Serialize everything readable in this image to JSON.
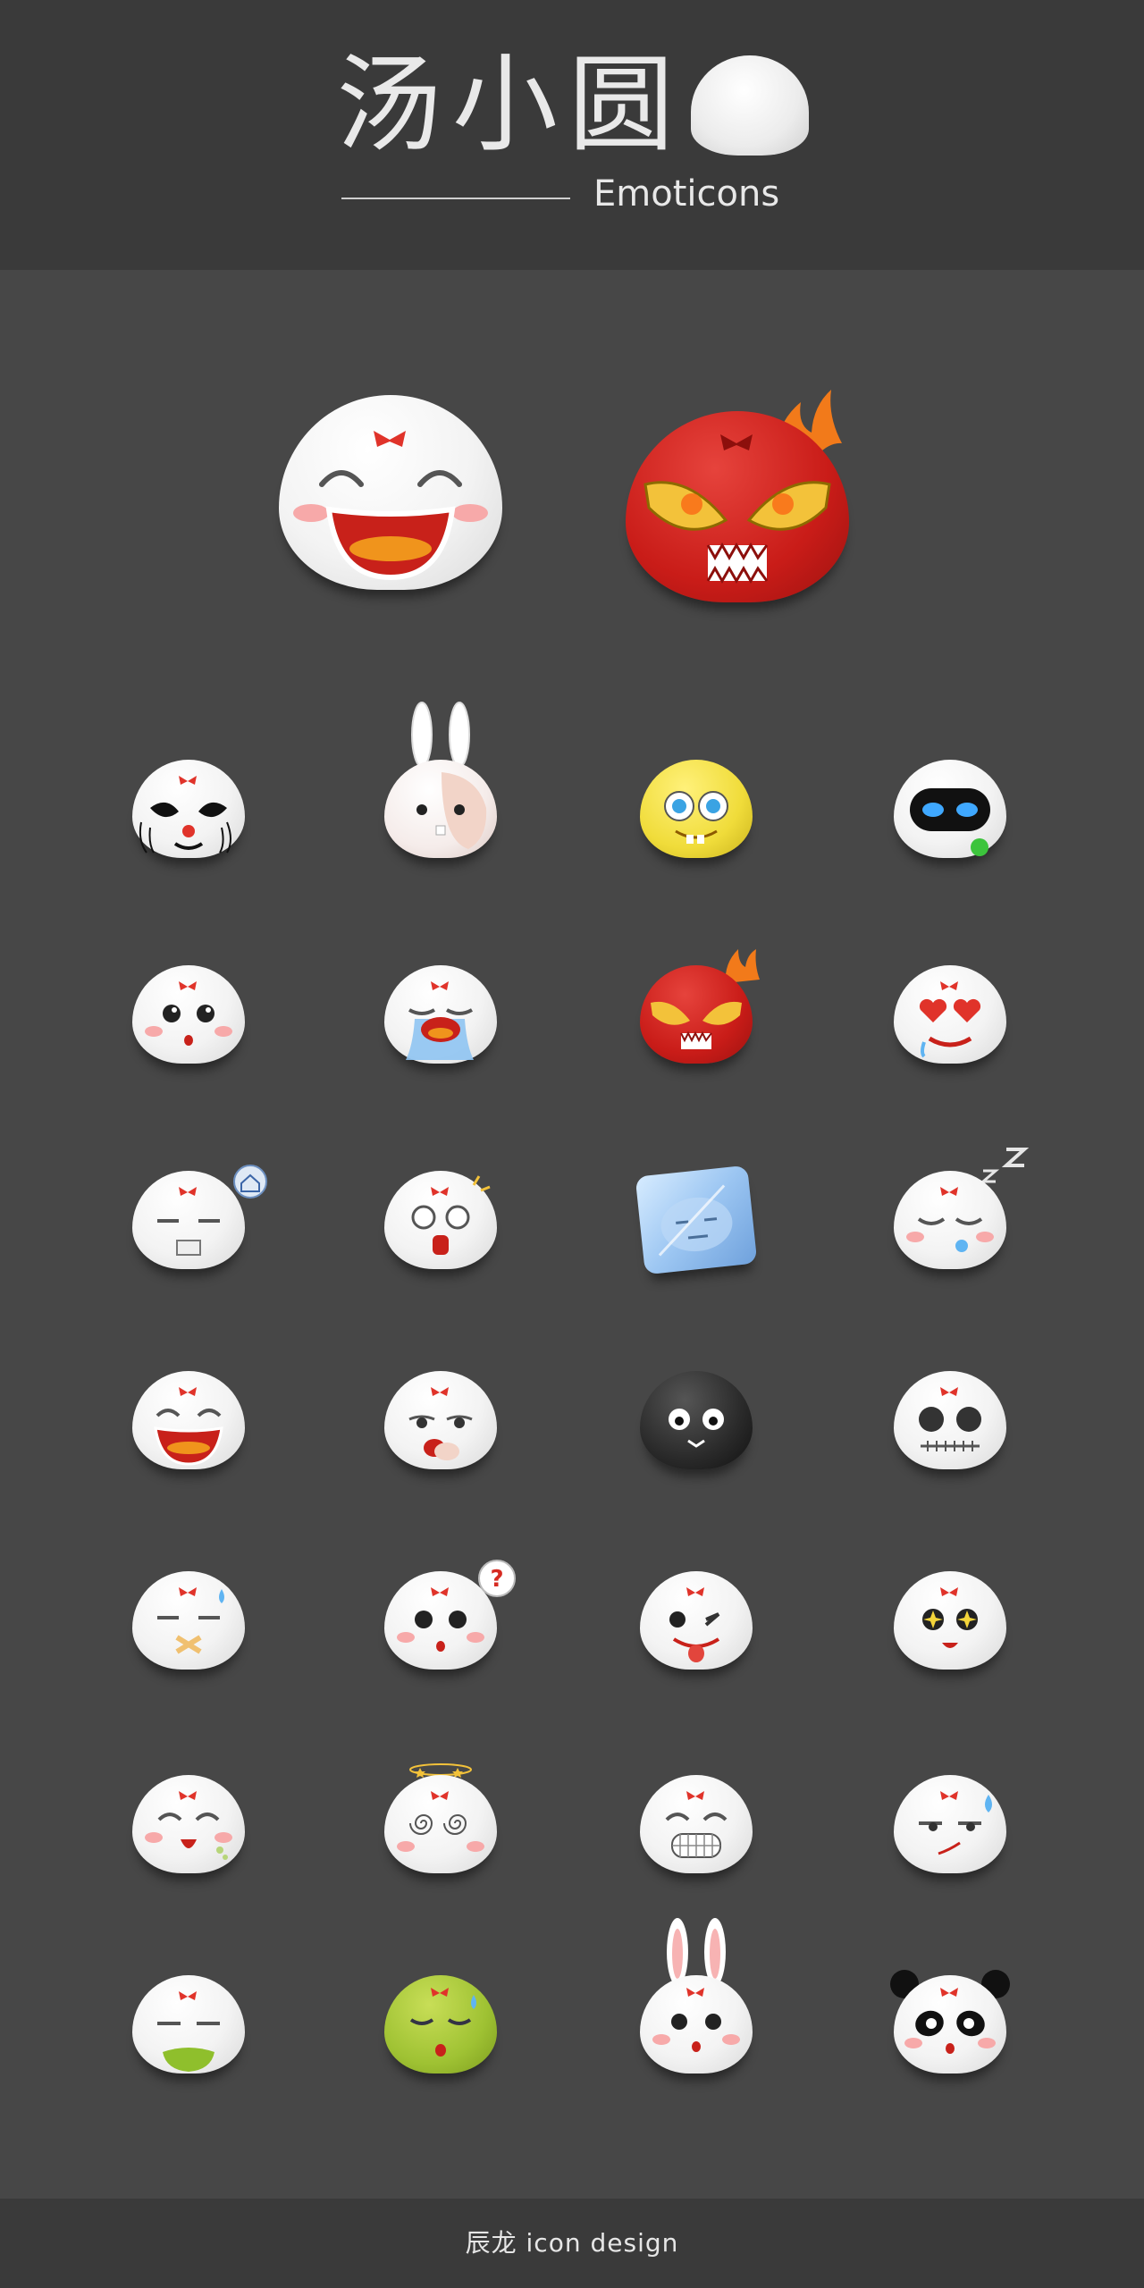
{
  "header": {
    "title": "汤小圆",
    "subtitle": "Emoticons"
  },
  "footer": {
    "credit": "辰龙 icon design"
  },
  "emoticons": [
    {
      "name": "laughing",
      "style": "white"
    },
    {
      "name": "furious",
      "style": "red"
    },
    {
      "name": "clown",
      "style": "white"
    },
    {
      "name": "bunny-patched",
      "style": "white"
    },
    {
      "name": "sponge",
      "style": "yellow"
    },
    {
      "name": "robot",
      "style": "white"
    },
    {
      "name": "surprised",
      "style": "white"
    },
    {
      "name": "crying",
      "style": "white"
    },
    {
      "name": "angry-fire",
      "style": "red"
    },
    {
      "name": "love-eyes",
      "style": "white"
    },
    {
      "name": "homesick",
      "style": "white"
    },
    {
      "name": "shocked",
      "style": "white"
    },
    {
      "name": "frozen",
      "style": "ice"
    },
    {
      "name": "sleeping",
      "style": "white"
    },
    {
      "name": "big-laugh",
      "style": "white"
    },
    {
      "name": "yawning",
      "style": "white"
    },
    {
      "name": "soot-sprite",
      "style": "black"
    },
    {
      "name": "skull",
      "style": "white"
    },
    {
      "name": "silenced",
      "style": "white"
    },
    {
      "name": "confused",
      "style": "white"
    },
    {
      "name": "tongue-wink",
      "style": "white"
    },
    {
      "name": "starry-eyes",
      "style": "white"
    },
    {
      "name": "giggle",
      "style": "white"
    },
    {
      "name": "dizzy",
      "style": "white"
    },
    {
      "name": "grin",
      "style": "white"
    },
    {
      "name": "smirk-sweat",
      "style": "white"
    },
    {
      "name": "vomiting",
      "style": "white"
    },
    {
      "name": "sick-green",
      "style": "green"
    },
    {
      "name": "bunny",
      "style": "white"
    },
    {
      "name": "panda",
      "style": "white"
    }
  ]
}
